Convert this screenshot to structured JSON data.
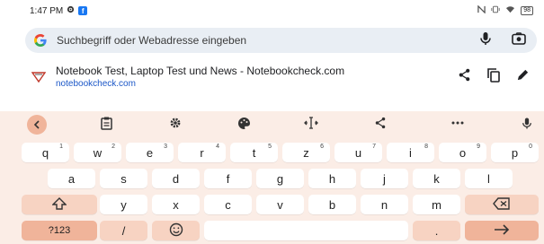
{
  "status_bar": {
    "time": "1:47 PM",
    "fb_glyph": "f",
    "battery": "98"
  },
  "search": {
    "placeholder": "Suchbegriff oder Webadresse eingeben",
    "google_letter": "G"
  },
  "suggestion": {
    "title": "Notebook Test, Laptop Test und News - Notebookcheck.com",
    "url": "notebookcheck.com"
  },
  "keyboard": {
    "row1": [
      {
        "label": "q",
        "hint": "1"
      },
      {
        "label": "w",
        "hint": "2"
      },
      {
        "label": "e",
        "hint": "3"
      },
      {
        "label": "r",
        "hint": "4"
      },
      {
        "label": "t",
        "hint": "5"
      },
      {
        "label": "z",
        "hint": "6"
      },
      {
        "label": "u",
        "hint": "7"
      },
      {
        "label": "i",
        "hint": "8"
      },
      {
        "label": "o",
        "hint": "9"
      },
      {
        "label": "p",
        "hint": "0"
      }
    ],
    "row2": [
      "a",
      "s",
      "d",
      "f",
      "g",
      "h",
      "j",
      "k",
      "l"
    ],
    "row3": [
      "y",
      "x",
      "c",
      "v",
      "b",
      "n",
      "m"
    ],
    "symbols_label": "?123",
    "slash_label": "/",
    "period_label": ".",
    "colors": {
      "panel": "#fbede6",
      "accent": "#f0b49a",
      "function": "#f7d3c2"
    }
  }
}
